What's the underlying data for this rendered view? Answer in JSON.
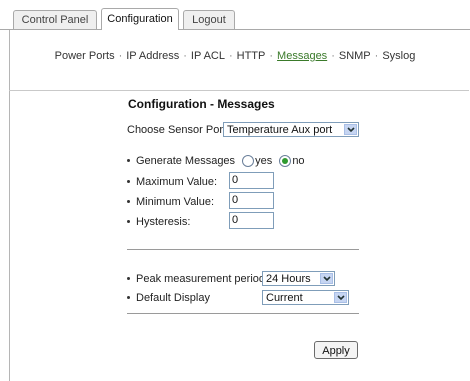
{
  "tabs": [
    {
      "label": "Control Panel"
    },
    {
      "label": "Configuration"
    },
    {
      "label": "Logout"
    }
  ],
  "subnav": [
    "Power Ports",
    "IP Address",
    "IP ACL",
    "HTTP",
    "Messages",
    "SNMP",
    "Syslog"
  ],
  "subnav_separator": "·",
  "page_title": "Configuration - Messages",
  "sensor_port": {
    "label": "Choose Sensor Port:",
    "value": "Temperature Aux port"
  },
  "generate": {
    "label": "Generate Messages",
    "yes": "yes",
    "no": "no",
    "selected": "no"
  },
  "max_value": {
    "label": "Maximum Value:",
    "value": "0"
  },
  "min_value": {
    "label": "Minimum Value:",
    "value": "0"
  },
  "hysteresis": {
    "label": "Hysteresis:",
    "value": "0"
  },
  "peak_period": {
    "label": "Peak measurement period",
    "value": "24 Hours"
  },
  "default_display": {
    "label": "Default Display",
    "value": "Current"
  },
  "apply_label": "Apply",
  "colors": {
    "active_link": "#3a7a2a",
    "radio_selected": "#2f9a2f"
  }
}
